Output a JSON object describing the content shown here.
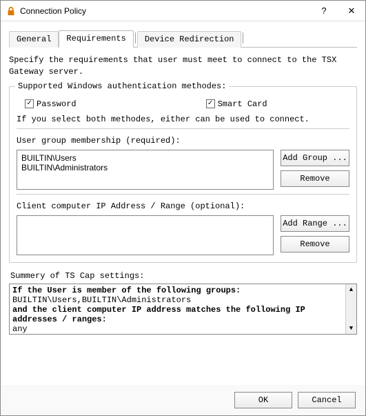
{
  "titlebar": {
    "title": "Connection Policy",
    "help_label": "?",
    "close_label": "✕"
  },
  "tabs": [
    {
      "label": "General"
    },
    {
      "label": "Requirements"
    },
    {
      "label": "Device Redirection"
    }
  ],
  "description": "Specify the requirements that user must meet to connect to the TSX Gateway server.",
  "auth_group": {
    "title": "Supported Windows authentication methodes:",
    "password_label": "Password",
    "smartcard_label": "Smart Card",
    "password_checked": true,
    "smartcard_checked": true,
    "both_hint": "If you select both methodes, either can be used to connect."
  },
  "user_group": {
    "title": "User group membership (required):",
    "items": [
      "BUILTIN\\Users",
      "BUILTIN\\Administrators"
    ],
    "add_label": "Add Group ...",
    "remove_label": "Remove"
  },
  "ip_group": {
    "title": "Client computer IP Address / Range (optional):",
    "items": [],
    "add_label": "Add Range ...",
    "remove_label": "Remove"
  },
  "summary": {
    "title": "Summery of TS Cap settings:",
    "lines": [
      {
        "text": "If the User is member of the following groups:",
        "bold": true
      },
      {
        "text": "BUILTIN\\Users,BUILTIN\\Administrators",
        "bold": false
      },
      {
        "text": "and the client computer IP address matches the following IP addresses / ranges:",
        "bold": true
      },
      {
        "text": "any",
        "bold": false
      }
    ]
  },
  "footer": {
    "ok_label": "OK",
    "cancel_label": "Cancel"
  }
}
